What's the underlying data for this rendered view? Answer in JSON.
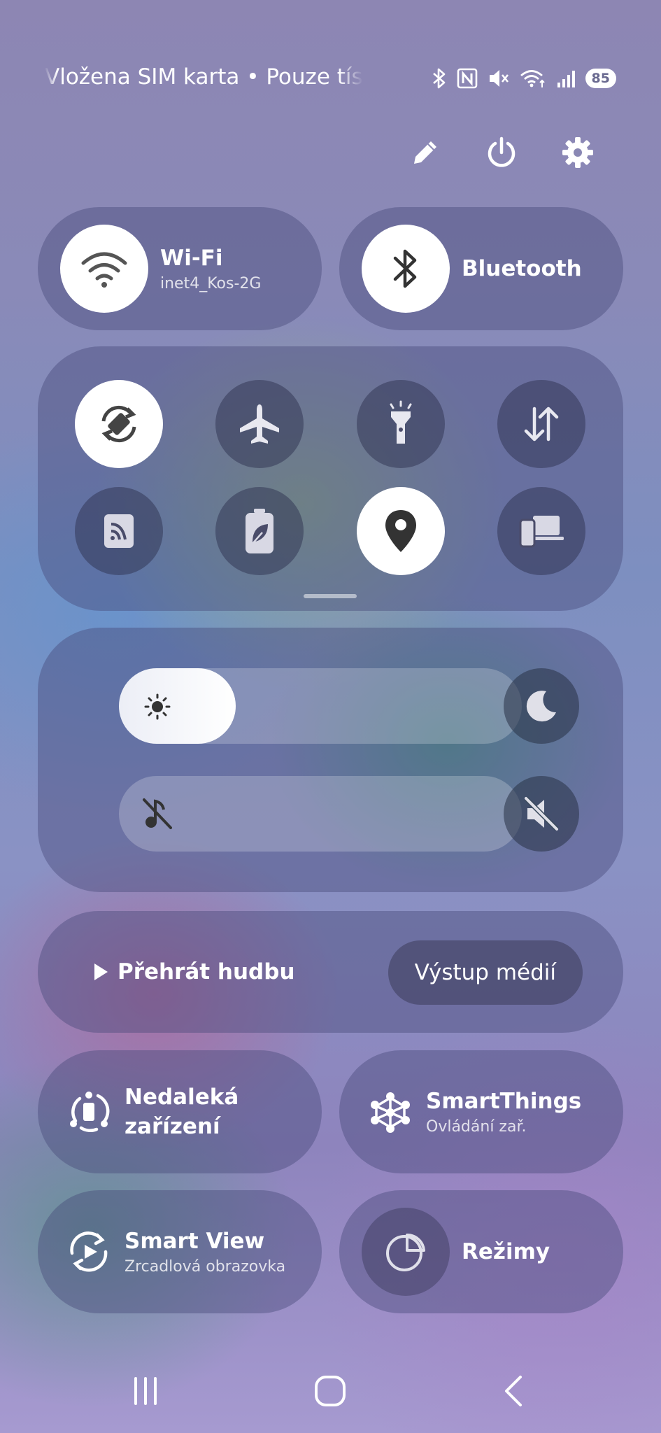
{
  "status_bar": {
    "carrier_text": "Vložena SIM karta • Pouze tísňová volání",
    "battery_level": "85",
    "icons": [
      "bluetooth-icon",
      "nfc-icon",
      "mute-icon",
      "wifi-icon",
      "signal-icon"
    ]
  },
  "top_actions": [
    "edit-icon",
    "power-icon",
    "settings-icon"
  ],
  "tiles": {
    "wifi": {
      "label": "Wi-Fi",
      "sublabel": "inet4_Kos-2G",
      "active": true
    },
    "bluetooth": {
      "label": "Bluetooth",
      "active": true
    }
  },
  "quick_toggles": [
    {
      "name": "auto-rotate",
      "icon": "rotate-icon",
      "active": true
    },
    {
      "name": "airplane-mode",
      "icon": "airplane-icon",
      "active": false
    },
    {
      "name": "flashlight",
      "icon": "flashlight-icon",
      "active": false
    },
    {
      "name": "mobile-data",
      "icon": "data-arrows-icon",
      "active": false
    },
    {
      "name": "nfc",
      "icon": "nfc-icon",
      "active": false
    },
    {
      "name": "power-saving",
      "icon": "battery-leaf-icon",
      "active": false
    },
    {
      "name": "location",
      "icon": "location-icon",
      "active": true
    },
    {
      "name": "link-to-windows",
      "icon": "devices-icon",
      "active": false
    }
  ],
  "sliders": {
    "brightness": {
      "level": 0.29
    },
    "volume": {
      "level": 0
    }
  },
  "media": {
    "play_label": "Přehrát hudbu",
    "output_label": "Výstup médií"
  },
  "shortcuts": {
    "nearby": {
      "label_line1": "Nedaleká",
      "label_line2": "zařízení"
    },
    "smartthings": {
      "label": "SmartThings",
      "sublabel": "Ovládání zař."
    },
    "smartview": {
      "label": "Smart View",
      "sublabel": "Zrcadlová obrazovka"
    },
    "modes": {
      "label": "Režimy"
    }
  },
  "colors": {
    "accent_dark_icon": "#3a3a4a",
    "tile_bg": "#464878"
  }
}
